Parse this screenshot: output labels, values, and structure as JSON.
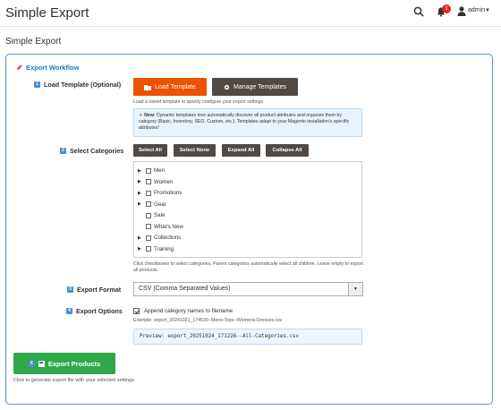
{
  "header": {
    "app_title": "Simple Export",
    "notification_count": "1",
    "username": "admin"
  },
  "page": {
    "title": "Simple Export"
  },
  "panel": {
    "title": "Export Workflow",
    "step1": {
      "number": "1",
      "label": "Load Template (Optional)",
      "load_button": "Load Template",
      "manage_button": "Manage Templates",
      "help": "Load a saved template to quickly configure your export settings",
      "notice_prefix": "New:",
      "notice_text": "Dynamic templates now automatically discover all product attributes and organize them by category (Basic, Inventory, SEO, Custom, etc.). Templates adapt to your Magento installation's specific attributes!"
    },
    "step2": {
      "number": "2",
      "label": "Select Categories",
      "buttons": [
        "Select All",
        "Select None",
        "Expand All",
        "Collapse All"
      ],
      "tree": [
        {
          "label": "Men",
          "has_children": true
        },
        {
          "label": "Women",
          "has_children": true
        },
        {
          "label": "Promotions",
          "has_children": true
        },
        {
          "label": "Gear",
          "has_children": true
        },
        {
          "label": "Sale",
          "has_children": false
        },
        {
          "label": "What's New",
          "has_children": false
        },
        {
          "label": "Collections",
          "has_children": true
        },
        {
          "label": "Training",
          "has_children": true
        }
      ],
      "help": "Click checkboxes to select categories. Parent categories automatically select all children. Leave empty to export all products."
    },
    "step3": {
      "number": "3",
      "label": "Export Format",
      "selected": "CSV (Comma Separated Values)"
    },
    "step4": {
      "number": "4",
      "label": "Export Options",
      "option_label": "Append category names to filename",
      "option_checked": true,
      "example": "Example: export_20241021_174530--Mens-Tops--Womens-Dresses.csv",
      "preview": "Preview: export_20251024_171226--All-Categories.csv"
    },
    "step5": {
      "number": "5",
      "button": "Export Products",
      "help": "Click to generate export file with your selected settings"
    }
  },
  "colors": {
    "accent_blue": "#1979c3",
    "orange": "#eb5202",
    "dark_button": "#514943",
    "green": "#2ea84b",
    "badge_red": "#e22626"
  }
}
